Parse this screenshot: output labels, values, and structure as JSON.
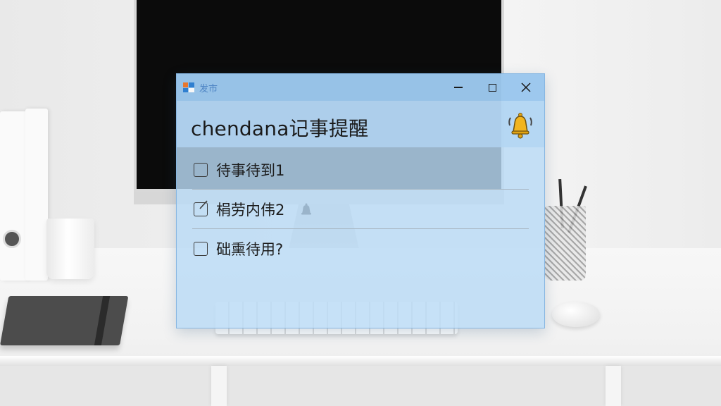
{
  "window": {
    "title": "发市",
    "controls": {
      "minimize": "minimize",
      "maximize": "maximize",
      "close": "close"
    }
  },
  "header": {
    "title": "chendana记事提醒",
    "bell_icon": "bell-icon"
  },
  "todos": [
    {
      "text": "待事待到1",
      "checked": false,
      "icon": "checkbox-icon"
    },
    {
      "text": "梋劳内伟2",
      "checked": false,
      "icon": "checkbox-edit-icon",
      "has_bell": true
    },
    {
      "text": "础熏待用?",
      "checked": false,
      "icon": "checkbox-icon"
    }
  ],
  "colors": {
    "window_bg": "#bad9f5",
    "titlebar_bg": "#96c4ec",
    "title_text": "#4d84c4",
    "bell_yellow": "#f2b51f"
  }
}
